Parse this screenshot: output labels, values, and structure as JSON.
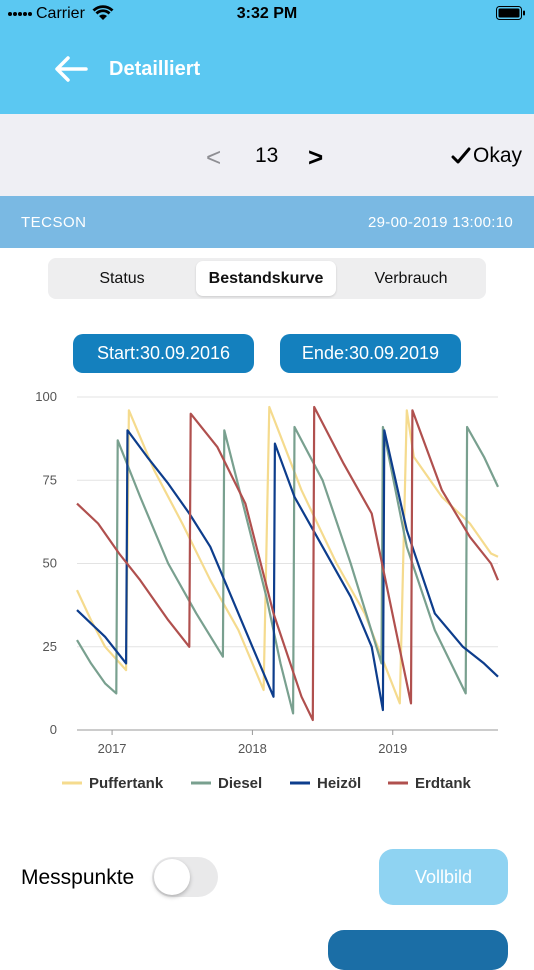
{
  "status_bar": {
    "carrier": "Carrier",
    "time": "3:32 PM"
  },
  "nav": {
    "title": "Detailliert"
  },
  "pager": {
    "prev": "<",
    "number": "13",
    "next": ">",
    "okay": "Okay"
  },
  "info": {
    "name": "TECSON",
    "datetime": "29-00-2019 13:00:10"
  },
  "segments": [
    {
      "label": "Status",
      "active": false
    },
    {
      "label": "Bestandskurve",
      "active": true
    },
    {
      "label": "Verbrauch",
      "active": false
    }
  ],
  "range": {
    "start": "Start:30.09.2016",
    "end": "Ende:30.09.2019"
  },
  "chart_data": {
    "type": "line",
    "title": "",
    "xlabel": "",
    "ylabel": "",
    "ylim": [
      0,
      100
    ],
    "xlim": [
      2016.75,
      2019.75
    ],
    "y_ticks": [
      "0",
      "25",
      "50",
      "75",
      "100"
    ],
    "x_ticks": [
      {
        "value": 2017,
        "label": "2017"
      },
      {
        "value": 2018,
        "label": "2018"
      },
      {
        "value": 2019,
        "label": "2019"
      }
    ],
    "grid": true,
    "legend_position": "bottom",
    "series": [
      {
        "name": "Puffertank",
        "color": "#f5db8e",
        "x": [
          2016.75,
          2016.85,
          2016.95,
          2017.1,
          2017.12,
          2017.3,
          2017.5,
          2017.7,
          2017.9,
          2018.08,
          2018.12,
          2018.35,
          2018.6,
          2018.8,
          2019.05,
          2019.1,
          2019.15,
          2019.35,
          2019.55,
          2019.7,
          2019.75
        ],
        "y": [
          42,
          33,
          25,
          18,
          96,
          78,
          62,
          45,
          30,
          12,
          97,
          72,
          50,
          35,
          8,
          96,
          82,
          70,
          62,
          53,
          52
        ]
      },
      {
        "name": "Diesel",
        "color": "#79a08f",
        "x": [
          2016.75,
          2016.85,
          2016.95,
          2017.03,
          2017.04,
          2017.2,
          2017.4,
          2017.6,
          2017.79,
          2017.8,
          2017.95,
          2018.1,
          2018.2,
          2018.29,
          2018.3,
          2018.5,
          2018.7,
          2018.92,
          2018.93,
          2019.1,
          2019.3,
          2019.52,
          2019.53,
          2019.65,
          2019.75
        ],
        "y": [
          27,
          20,
          14,
          11,
          87,
          70,
          50,
          35,
          22,
          90,
          65,
          40,
          20,
          5,
          91,
          75,
          50,
          20,
          91,
          55,
          30,
          11,
          91,
          82,
          73
        ]
      },
      {
        "name": "Heizöl",
        "color": "#0d3d8c",
        "x": [
          2016.75,
          2016.85,
          2016.95,
          2017.1,
          2017.11,
          2017.25,
          2017.4,
          2017.55,
          2017.7,
          2017.85,
          2018.0,
          2018.15,
          2018.16,
          2018.3,
          2018.5,
          2018.7,
          2018.85,
          2018.93,
          2018.94,
          2019.1,
          2019.3,
          2019.5,
          2019.65,
          2019.75
        ],
        "y": [
          36,
          32,
          28,
          20,
          90,
          82,
          74,
          65,
          55,
          40,
          25,
          10,
          86,
          70,
          55,
          40,
          25,
          6,
          90,
          60,
          35,
          25,
          20,
          16
        ]
      },
      {
        "name": "Erdtank",
        "color": "#b0504e",
        "x": [
          2016.75,
          2016.9,
          2017.05,
          2017.2,
          2017.4,
          2017.55,
          2017.56,
          2017.75,
          2017.95,
          2018.15,
          2018.35,
          2018.43,
          2018.44,
          2018.65,
          2018.85,
          2019.13,
          2019.14,
          2019.35,
          2019.55,
          2019.7,
          2019.75
        ],
        "y": [
          68,
          62,
          53,
          45,
          33,
          25,
          95,
          85,
          68,
          35,
          10,
          3,
          97,
          80,
          65,
          8,
          96,
          72,
          58,
          50,
          45
        ]
      }
    ]
  },
  "controls": {
    "messpunkte_label": "Messpunkte",
    "messpunkte_on": false,
    "vollbild_label": "Vollbild"
  },
  "colors": {
    "nav_bg": "#5bc8f2",
    "info_bg": "#7ab9e3",
    "pill_bg": "#1480be",
    "vollbild_bg": "#8fd3f2"
  }
}
